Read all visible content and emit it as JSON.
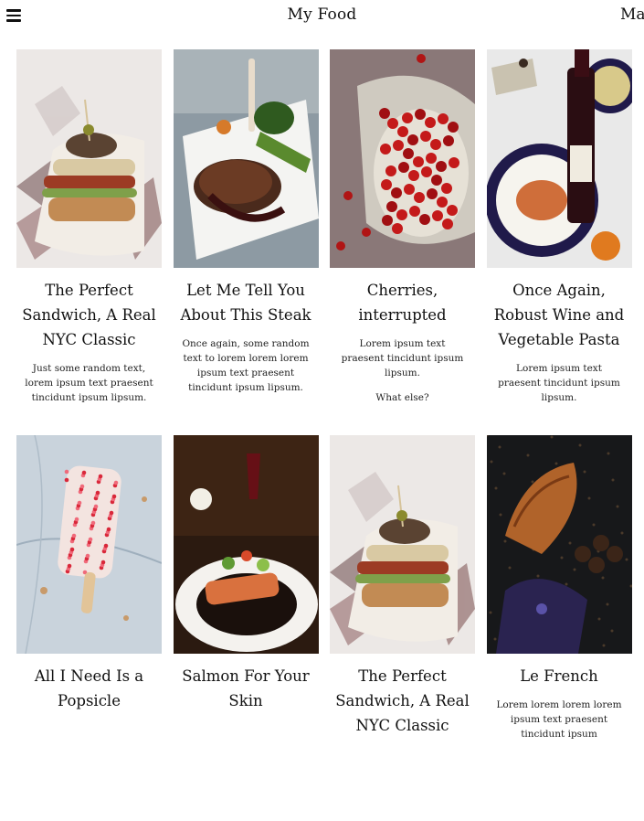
{
  "header": {
    "title": "My Food",
    "right_label": "Ma"
  },
  "cards": [
    {
      "title": "The Perfect Sandwich, A Real NYC Classic",
      "paragraphs": [
        "Just some random text, lorem ipsum text praesent tincidunt ipsum lipsum."
      ],
      "image": "sandwich-photo"
    },
    {
      "title": "Let Me Tell You About This Steak",
      "paragraphs": [
        "Once again, some random text to lorem lorem lorem ipsum text praesent tincidunt ipsum lipsum."
      ],
      "image": "steak-photo"
    },
    {
      "title": "Cherries, interrupted",
      "paragraphs": [
        "Lorem ipsum text praesent tincidunt ipsum lipsum.",
        "What else?"
      ],
      "image": "cherries-photo"
    },
    {
      "title": "Once Again, Robust Wine and Vegetable Pasta",
      "paragraphs": [
        "Lorem ipsum text praesent tincidunt ipsum lipsum."
      ],
      "image": "wine-pasta-photo"
    },
    {
      "title": "All I Need Is a Popsicle",
      "paragraphs": [],
      "image": "popsicle-photo"
    },
    {
      "title": "Salmon For Your Skin",
      "paragraphs": [],
      "image": "salmon-photo"
    },
    {
      "title": "The Perfect Sandwich, A Real NYC Classic",
      "paragraphs": [],
      "image": "sandwich-photo"
    },
    {
      "title": "Le French",
      "paragraphs": [
        "Lorem lorem lorem lorem ipsum text praesent tincidunt ipsum"
      ],
      "image": "croissant-photo"
    }
  ]
}
